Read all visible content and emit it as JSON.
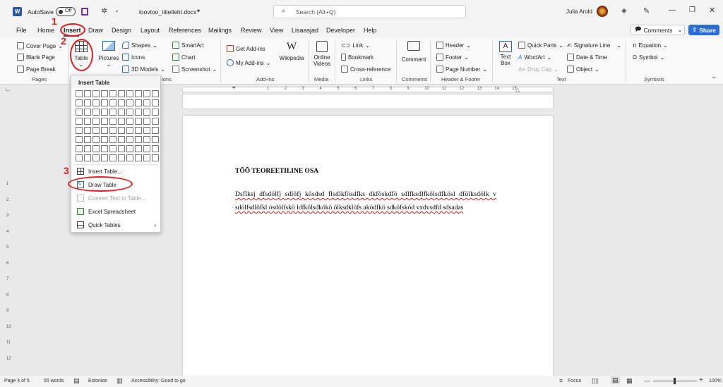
{
  "titlebar": {
    "autosave_label": "AutoSave",
    "toggle_label": "Off",
    "filename": "loovtoo_tiitelleht.docx",
    "search_placeholder": "Search (Alt+Q)",
    "user_name": "Julia Arold"
  },
  "menu": {
    "tabs": [
      "File",
      "Home",
      "Insert",
      "Draw",
      "Design",
      "Layout",
      "References",
      "Mailings",
      "Review",
      "View",
      "Lisaasjad",
      "Developer",
      "Help"
    ],
    "comments_label": "Comments",
    "share_label": "Share"
  },
  "ribbon": {
    "pages": {
      "cover_page": "Cover Page",
      "blank_page": "Blank Page",
      "page_break": "Page Break",
      "group": "Pages"
    },
    "table": {
      "label": "Table"
    },
    "illustrations": {
      "pictures": "Pictures",
      "shapes": "Shapes",
      "icons": "Icons",
      "models": "3D Models",
      "smartart": "SmartArt",
      "chart": "Chart",
      "screenshot": "Screenshot",
      "group": "ions"
    },
    "addins": {
      "get": "Get Add-ins",
      "my": "My Add-ins",
      "wikipedia": "Wikipedia",
      "group": "Add-ins"
    },
    "media": {
      "online_videos_1": "Online",
      "online_videos_2": "Videos",
      "group": "Media"
    },
    "links": {
      "link": "Link",
      "bookmark": "Bookmark",
      "cross_ref": "Cross-reference",
      "group": "Links"
    },
    "comments": {
      "comment": "Comment",
      "group": "Comments"
    },
    "header_footer": {
      "header": "Header",
      "footer": "Footer",
      "page_number": "Page Number",
      "group": "Header & Footer"
    },
    "text": {
      "text_box_1": "Text",
      "text_box_2": "Box",
      "quick_parts": "Quick Parts",
      "wordart": "WordArt",
      "drop_cap": "Drop Cap",
      "signature_line": "Signature Line",
      "date_time": "Date & Time",
      "object": "Object",
      "group": "Text"
    },
    "symbols": {
      "equation": "Equation",
      "symbol": "Symbol",
      "group": "Symbols"
    }
  },
  "dropdown": {
    "title": "Insert Table",
    "items": [
      "Insert Table...",
      "Draw Table",
      "Convert Text to Table...",
      "Excel Spreadsheet",
      "Quick Tables"
    ],
    "disabled_index": 2
  },
  "annotations": {
    "one": "1",
    "two": "2",
    "three": "3",
    "color": "#e02020"
  },
  "document": {
    "heading": "TÕÕ TEOREETILINE OSA",
    "para_line1": "Dsflksj dfsdölfj sdlöfj kösdsd flsdlkfösdfks dkföskdfö sdlfksdlfkölsdfkösl dfölksdölk v",
    "para_line2": "sdölfsdlöfkl ösdölfskö ldfkölsdkökö ölksdklöfs aködfkö sdköfsköd vxdvsdfd sdsadas"
  },
  "status": {
    "page": "Page 4 of 5",
    "words": "55 words",
    "language": "Estonian",
    "accessibility": "Accessibility: Good to go",
    "focus": "Focus",
    "zoom": "100%"
  },
  "ruler_ticks": [
    "1",
    "2",
    "3",
    "4",
    "5",
    "6",
    "7",
    "8",
    "9",
    "10",
    "11",
    "12",
    "13",
    "14",
    "15"
  ],
  "vruler_ticks": [
    "1",
    "2",
    "3",
    "4",
    "5",
    "6",
    "7",
    "8",
    "9",
    "10",
    "11",
    "12"
  ],
  "colors": {
    "accent": "#2b579a",
    "share_bg": "#2b6cdb"
  }
}
